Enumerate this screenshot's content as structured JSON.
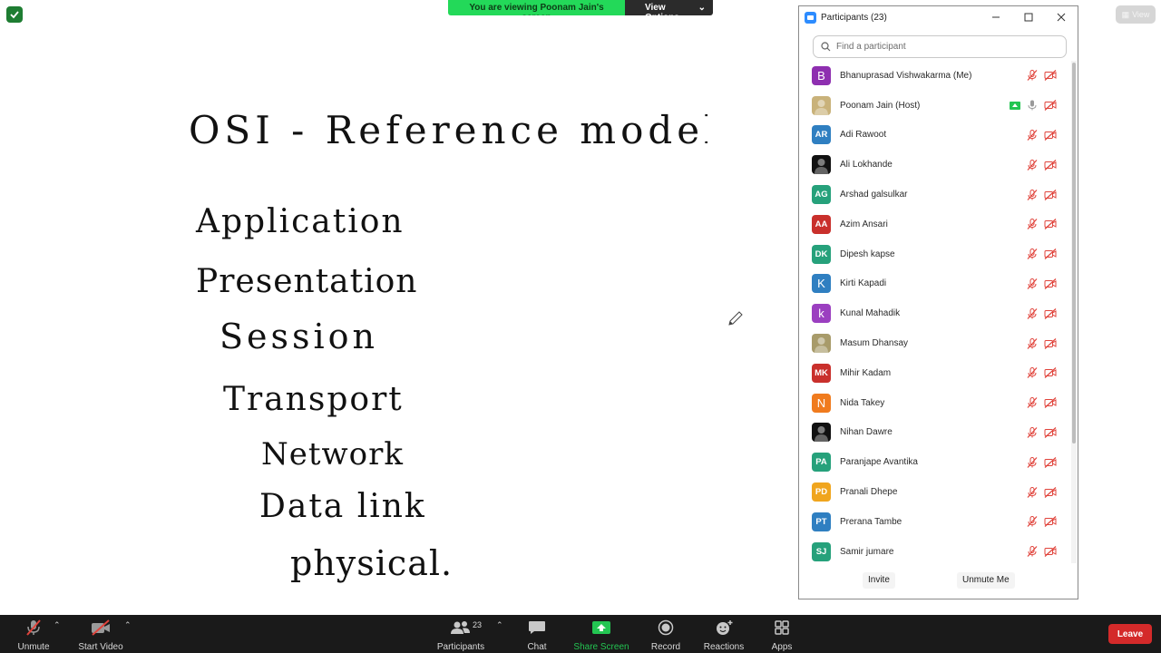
{
  "banner": {
    "viewing_text": "You are viewing Poonam Jain's screen",
    "view_options_label": "View Options"
  },
  "view_button_label": "View",
  "whiteboard": {
    "title": "OSI - Reference model.",
    "layers": [
      "Application",
      "Presentation",
      "Session",
      "Transport",
      "Network",
      "Data link",
      "physical."
    ]
  },
  "participants_panel": {
    "title": "Participants (23)",
    "search_placeholder": "Find a participant",
    "participants": [
      {
        "name": "Bhanuprasad Vishwakarma (Me)",
        "initials": "B",
        "avatar_color": "#8e2fb0",
        "avatar_type": "big"
      },
      {
        "name": "Poonam Jain (Host)",
        "initials": "",
        "avatar_color": "#c9b27a",
        "avatar_type": "photo",
        "sharing": true
      },
      {
        "name": "Adi Rawoot",
        "initials": "AR",
        "avatar_color": "#2f7fc1",
        "avatar_type": "initials"
      },
      {
        "name": "Ali Lokhande",
        "initials": "",
        "avatar_color": "#111111",
        "avatar_type": "photo"
      },
      {
        "name": "Arshad galsulkar",
        "initials": "AG",
        "avatar_color": "#26a17b",
        "avatar_type": "initials"
      },
      {
        "name": "Azim Ansari",
        "initials": "AA",
        "avatar_color": "#c9302c",
        "avatar_type": "initials"
      },
      {
        "name": "Dipesh kapse",
        "initials": "DK",
        "avatar_color": "#26a17b",
        "avatar_type": "initials"
      },
      {
        "name": "Kirti Kapadi",
        "initials": "K",
        "avatar_color": "#2f7fc1",
        "avatar_type": "big"
      },
      {
        "name": "Kunal Mahadik",
        "initials": "k",
        "avatar_color": "#9b3fc0",
        "avatar_type": "big"
      },
      {
        "name": "Masum Dhansay",
        "initials": "",
        "avatar_color": "#a89b6a",
        "avatar_type": "photo"
      },
      {
        "name": "Mihir Kadam",
        "initials": "MK",
        "avatar_color": "#c9302c",
        "avatar_type": "initials"
      },
      {
        "name": "Nida Takey",
        "initials": "N",
        "avatar_color": "#f07b1e",
        "avatar_type": "big"
      },
      {
        "name": "Nihan Dawre",
        "initials": "",
        "avatar_color": "#111111",
        "avatar_type": "photo"
      },
      {
        "name": "Paranjape Avantika",
        "initials": "PA",
        "avatar_color": "#26a17b",
        "avatar_type": "initials"
      },
      {
        "name": "Pranali Dhepe",
        "initials": "PD",
        "avatar_color": "#f0a51e",
        "avatar_type": "initials"
      },
      {
        "name": "Prerana Tambe",
        "initials": "PT",
        "avatar_color": "#2f7fc1",
        "avatar_type": "initials"
      },
      {
        "name": "Samir jumare",
        "initials": "SJ",
        "avatar_color": "#26a17b",
        "avatar_type": "initials"
      }
    ],
    "invite_label": "Invite",
    "unmute_me_label": "Unmute Me"
  },
  "toolbar": {
    "unmute": "Unmute",
    "start_video": "Start Video",
    "participants": "Participants",
    "participants_count": "23",
    "chat": "Chat",
    "share_screen": "Share Screen",
    "record": "Record",
    "reactions": "Reactions",
    "apps": "Apps",
    "leave": "Leave"
  },
  "colors": {
    "share_green": "#23c552",
    "leave_red": "#d42a2a",
    "muted_red": "#e0433b",
    "toolbar_bg": "#1a1a1a"
  }
}
